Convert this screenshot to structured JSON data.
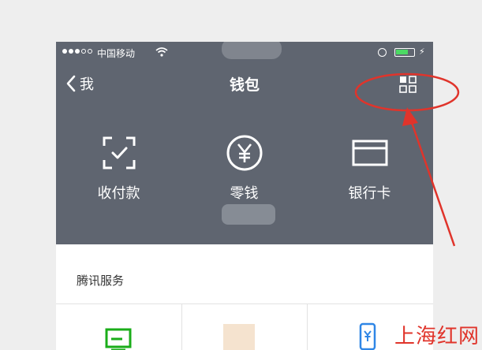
{
  "status_bar": {
    "carrier": "中国移动",
    "battery_level": 0.7
  },
  "nav": {
    "back_label": "我",
    "title": "钱包"
  },
  "actions": [
    {
      "label": "收付款",
      "icon": "scan-pay-icon"
    },
    {
      "label": "零钱",
      "icon": "yuan-coin-icon"
    },
    {
      "label": "银行卡",
      "icon": "bank-card-icon"
    }
  ],
  "services": {
    "title": "腾讯服务",
    "icons": [
      "green-card-icon",
      "blurred-service-icon",
      "phone-yuan-icon"
    ]
  },
  "watermark": "上海红网",
  "colors": {
    "header_bg": "#5f6570",
    "annotation": "#e0342b",
    "accent_green": "#1aad19",
    "accent_blue": "#2f86e6"
  }
}
